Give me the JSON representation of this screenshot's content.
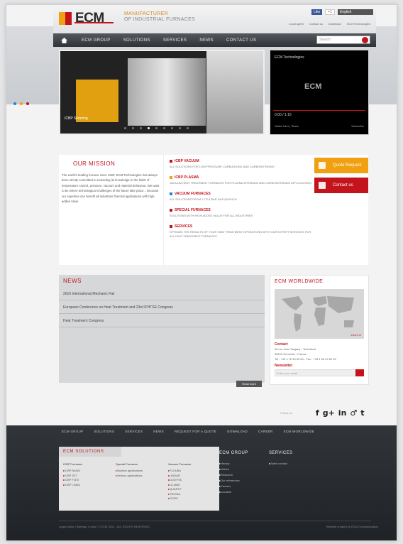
{
  "header": {
    "logo_text": "ECM",
    "tagline_1": "MANUFACTURER",
    "tagline_2": "OF INDUSTRIAL FURNACES",
    "fb_like": "Like",
    "gplus": "+1",
    "lang": "English",
    "top_links": [
      "Local agent",
      "Contact us",
      "Download",
      "ECM Technologies"
    ]
  },
  "nav": {
    "items": [
      "ECM GROUP",
      "SOLUTIONS",
      "SERVICES",
      "NEWS",
      "CONTACT US"
    ],
    "search_placeholder": "Search"
  },
  "slider": {
    "caption": "ICBP Sintering"
  },
  "video": {
    "title": "ECM Technologies",
    "logo": "ECM",
    "time": "0:00 / 1:15",
    "footer": "Watch later | Share",
    "sub": "Subscribe"
  },
  "mission": {
    "title": "OUR MISSION",
    "text": "The world's leading furnace since 1928, ECM Technologies has always been strictly committed to extending its knowledge in the fields of temperature control, pressure, vacuum and material behaviour. We want to be where technological challenges of the future take place... because our expertise can benefit all industries' thermal applications with high added value.",
    "list": [
      {
        "title": "ICBP VACUUM",
        "desc": "ALL SOLUTIONS FOR LOW PRESSURE CARBURIZING AND CARBONITRIDING",
        "color": "#c3141d"
      },
      {
        "title": "ICBP PLASMA",
        "desc": "VACUUM HEAT TREATMENT FURNACES FOR PLASMA NITRIDING AND CARBONITRIDING APPLICATIONS",
        "color": "#f0a011"
      },
      {
        "title": "VACUUM FURNACES",
        "desc": "ALL SOLUTIONS FROM 1 TO 8 BAR GAS QUENCH",
        "color": "#1e88c8"
      },
      {
        "title": "SPECIAL FURNACES",
        "desc": "SOLUTIONS WITH HIGH ADDED VALUE FOR ALL INDUSTRIES",
        "color": "#c3141d"
      },
      {
        "title": "SERVICES",
        "desc": "OPTIMIZE THE RESULTS OF YOUR HEAT TREATMENT OPERATIONS WITH OUR EXPERT SERVICES FOR ALL HEAT TREATMENT FURNACES",
        "color": "#c3141d"
      }
    ],
    "quote_btn": "Quote Request",
    "contact_btn": "Contact us"
  },
  "news": {
    "title": "NEWS",
    "items": [
      "2016 International Mechanic Fair",
      "European Conference on Heat Treatment and 23rd IFHTSE Congress",
      "Heat Treatment Congress"
    ],
    "more": "Read more"
  },
  "worldwide": {
    "title": "ECM WORLDWIDE",
    "map_link": "Zoom in",
    "contact_label": "Contact",
    "addr_1": "46 rue Jean Vaujany - Technisud",
    "addr_2": "38100 Grenoble - France",
    "addr_3": "Tel : +33 4 76 49 65 60 - Fax : +33 4 56 49 62 59",
    "newsletter_label": "Newsletter",
    "newsletter_placeholder": "Enter your email"
  },
  "follow": {
    "label": "Follow us",
    "icons": [
      "f",
      "g+",
      "in",
      "♂",
      "t"
    ]
  },
  "footer": {
    "nav": [
      "ECM GROUP",
      "SOLUTIONS",
      "SERVICES",
      "NEWS",
      "REQUEST FOR A QUOTE",
      "DOWNLOAD",
      "CAREER",
      "ECM WORLDWIDE"
    ],
    "solutions_title": "ECM SOLUTIONS",
    "col1_head": "ICBP Furnaces",
    "col1": [
      "ICBP NANO",
      "ICBP JET",
      "ICBP FLEX",
      "ICBP LINEA"
    ],
    "col2_head": "Special Furnaces",
    "col2": [
      "Nuclear applications",
      "Various applications"
    ],
    "col3_head": "Vacuum Furnaces",
    "col3": [
      "FLOUBA",
      "LINDAR",
      "DUOTHA",
      "LILIANE",
      "QUARTZ",
      "TRIODA",
      "SOFIE"
    ],
    "group_title": "ECM GROUP",
    "group": [
      "History",
      "Values",
      "Research",
      "Our references",
      "Careers",
      "Location"
    ],
    "services_title": "SERVICES",
    "services": [
      "Sales contact"
    ],
    "bottom_left": "Legal notice | Sitemap | Links | © ECM 2014 - ALL RIGHTS RESERVED",
    "bottom_right": "Website created by ECM Communication"
  },
  "colors": {
    "accent": "#c3141d",
    "orange": "#f0a011",
    "blue": "#1e88c8",
    "dark": "#2f3236"
  }
}
